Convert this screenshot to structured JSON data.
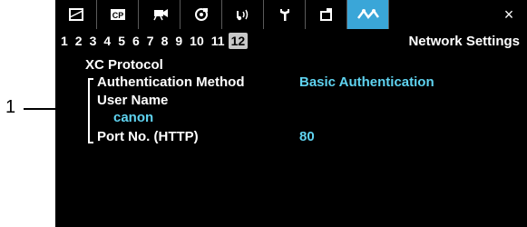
{
  "callout": {
    "number": "1"
  },
  "tabs": [
    {
      "icon": "camera-frame-icon"
    },
    {
      "icon": "cp-icon",
      "label": "CP"
    },
    {
      "icon": "video-camera-icon"
    },
    {
      "icon": "media-icon"
    },
    {
      "icon": "audio-icon"
    },
    {
      "icon": "wrench-icon"
    },
    {
      "icon": "monitor-output-icon"
    },
    {
      "icon": "network-icon"
    },
    {
      "icon": "close-icon",
      "label": "×"
    }
  ],
  "pages": [
    "1",
    "2",
    "3",
    "4",
    "5",
    "6",
    "7",
    "8",
    "9",
    "10",
    "11",
    "12"
  ],
  "current_page": "12",
  "section_title": "Network Settings",
  "protocol_heading": "XC Protocol",
  "settings": {
    "auth_label": "Authentication Method",
    "auth_value": "Basic Authentication",
    "user_label": "User Name",
    "user_value": "canon",
    "port_label": "Port No. (HTTP)",
    "port_value": "80"
  },
  "colors": {
    "accent": "#3aa6d8",
    "value_text": "#5fd3f0",
    "background": "#000000"
  }
}
